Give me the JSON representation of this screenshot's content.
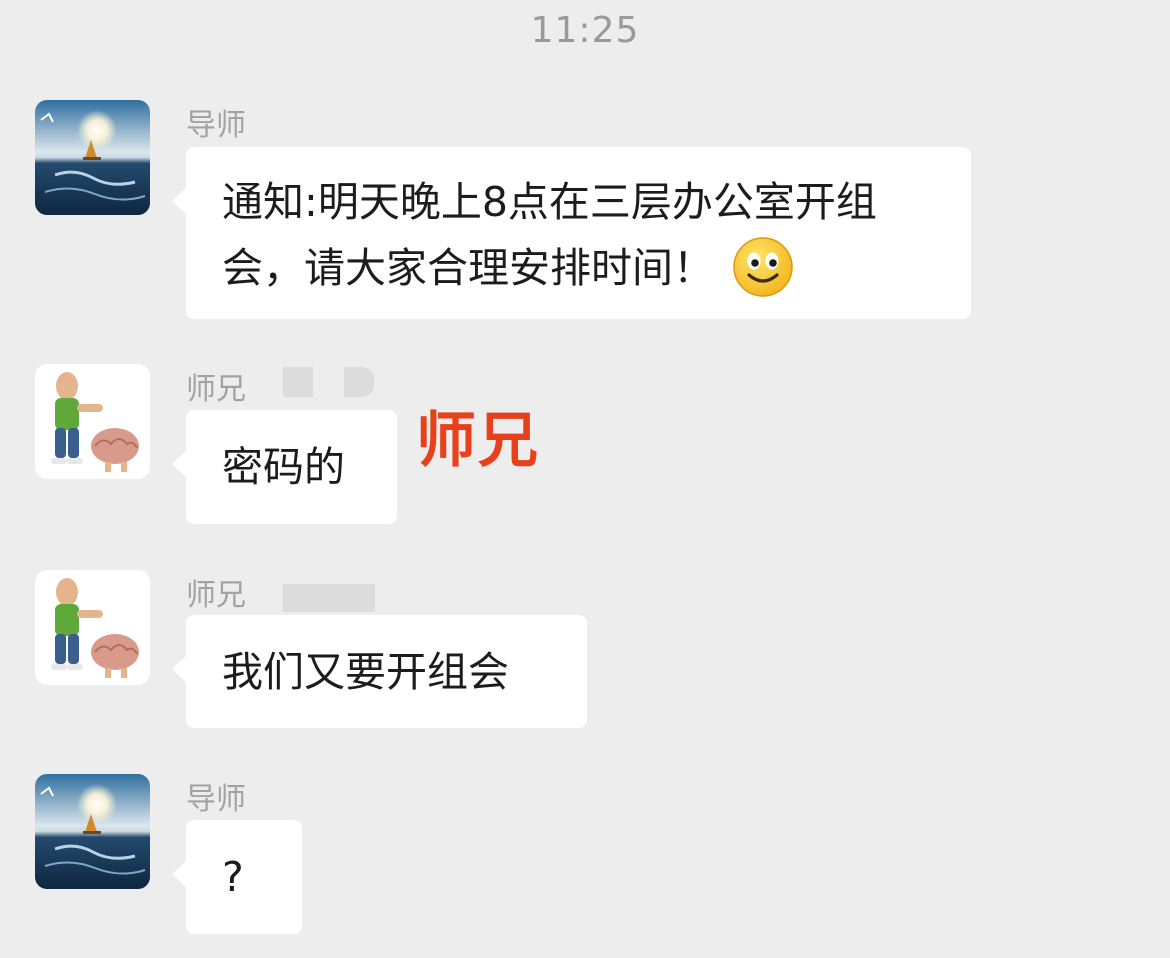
{
  "timestamp": "11:25",
  "messages": [
    {
      "sender": "导师",
      "avatar": "ocean-sailboat-avatar",
      "text": "通知:明天晚上8点在三层办公室开组会，请大家合理安排时间！",
      "emoji": "smile-emoji"
    },
    {
      "sender": "师兄",
      "avatar": "man-with-brain-avatar",
      "text": "密码的"
    },
    {
      "sender": "师兄",
      "avatar": "man-with-brain-avatar",
      "text": "我们又要开组会"
    },
    {
      "sender": "导师",
      "avatar": "ocean-sailboat-avatar",
      "text": "?"
    }
  ],
  "annotation": {
    "text": "师兄",
    "color": "#e8401a"
  },
  "colors": {
    "background": "#ededed",
    "bubble": "#ffffff",
    "sender_name": "#a2a2a2",
    "timestamp": "#9a9a9a"
  }
}
